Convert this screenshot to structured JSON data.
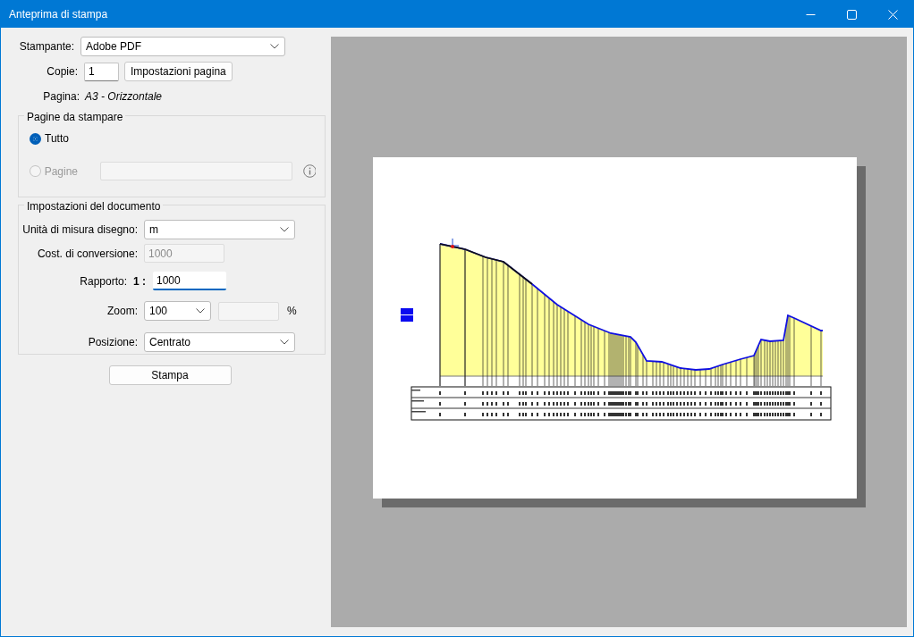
{
  "window": {
    "title": "Anteprima di stampa"
  },
  "printer": {
    "label": "Stampante:",
    "value": "Adobe PDF"
  },
  "copies": {
    "label": "Copie:",
    "value": "1"
  },
  "page_setup_button": "Impostazioni pagina",
  "page": {
    "label": "Pagina:",
    "value": "A3 - Orizzontale"
  },
  "pages_group": {
    "title": "Pagine da stampare",
    "options": [
      {
        "label": "Tutto",
        "selected": true,
        "disabled": false
      },
      {
        "label": "Pagine",
        "selected": false,
        "disabled": true
      }
    ]
  },
  "document_settings": {
    "title": "Impostazioni del documento",
    "unit": {
      "label": "Unità di misura disegno:",
      "value": "m"
    },
    "conversion": {
      "label": "Cost. di conversione:",
      "value": "1000",
      "disabled": true
    },
    "ratio": {
      "label": "Rapporto:",
      "prefix": "1 :",
      "value": "1000"
    },
    "zoom": {
      "label": "Zoom:",
      "value": "100",
      "unit": "%"
    },
    "position": {
      "label": "Posizione:",
      "value": "Centrato"
    }
  },
  "print_button": "Stampa"
}
